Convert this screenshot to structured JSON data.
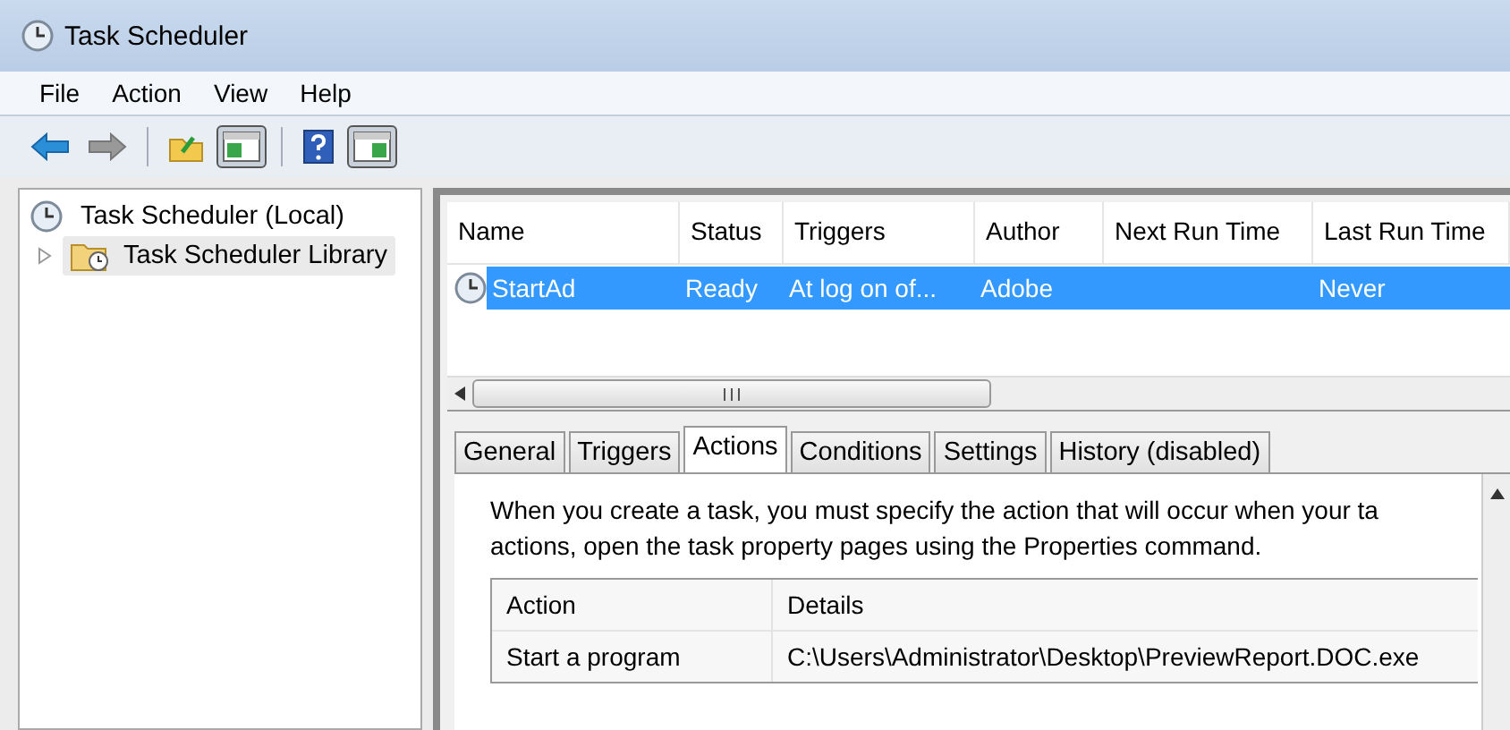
{
  "window": {
    "title": "Task Scheduler"
  },
  "menu": [
    "File",
    "Action",
    "View",
    "Help"
  ],
  "toolbar": [
    {
      "kind": "back",
      "pressed": false
    },
    {
      "kind": "forward",
      "pressed": false
    },
    {
      "kind": "sep"
    },
    {
      "kind": "folder",
      "pressed": false
    },
    {
      "kind": "pane-left",
      "pressed": true
    },
    {
      "kind": "sep"
    },
    {
      "kind": "help",
      "pressed": false
    },
    {
      "kind": "pane-right",
      "pressed": true
    }
  ],
  "tree": [
    {
      "label": "Task Scheduler (Local)",
      "selected": false,
      "children": [
        {
          "label": "Task Scheduler Library",
          "selected": true,
          "expanded": false
        }
      ]
    }
  ],
  "task_table": {
    "columns": [
      "Name",
      "Status",
      "Triggers",
      "Author",
      "Next Run Time",
      "Last Run Time"
    ],
    "rows": [
      {
        "selected": true,
        "cells": [
          "StartAd",
          "Ready",
          "At log on of...",
          "Adobe",
          "",
          "Never"
        ]
      }
    ]
  },
  "tabs": [
    {
      "label": "General",
      "selected": false
    },
    {
      "label": "Triggers",
      "selected": false
    },
    {
      "label": "Actions",
      "selected": true
    },
    {
      "label": "Conditions",
      "selected": false
    },
    {
      "label": "Settings",
      "selected": false
    },
    {
      "label": "History (disabled)",
      "selected": false
    }
  ],
  "description": "When you create a task, you must specify the action that will occur when your ta",
  "description_2": "actions, open the task property pages using the Properties command.",
  "actions_table": {
    "columns": [
      "Action",
      "Details"
    ],
    "rows": [
      [
        "Start a program",
        "C:\\Users\\Administrator\\Desktop\\PreviewReport.DOC.exe"
      ]
    ]
  }
}
